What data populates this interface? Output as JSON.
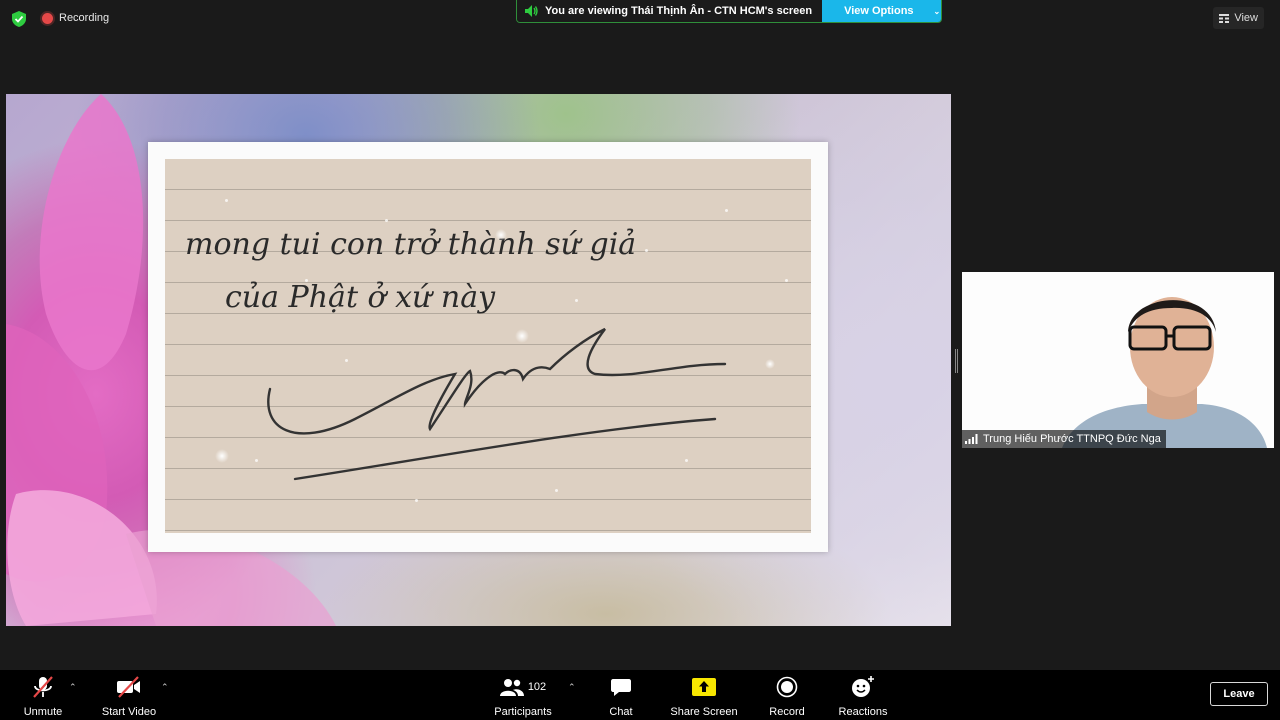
{
  "top_bar": {
    "recording_label": "Recording",
    "viewing_text": "You are viewing Thái Thịnh Ân - CTN HCM's screen",
    "view_options_label": "View Options",
    "view_label": "View"
  },
  "shared_screen": {
    "handwriting_line1": "mong tui con trở thành sứ giả",
    "handwriting_line2": "của Phật ở xứ này"
  },
  "participant_tile": {
    "name": "Trung Hiếu Phước TTNPQ Đức Nga"
  },
  "toolbar": {
    "unmute": "Unmute",
    "start_video": "Start Video",
    "participants": "Participants",
    "participants_count": "102",
    "chat": "Chat",
    "share_screen": "Share Screen",
    "record": "Record",
    "reactions": "Reactions",
    "leave": "Leave"
  },
  "colors": {
    "accent": "#1ab7ea",
    "recording": "#e54848",
    "secure": "#2ecc40",
    "share_screen": "#f7e600"
  },
  "icons": [
    "shield-check-icon",
    "recording-icon",
    "speaker-icon",
    "chevron-down-icon",
    "grid-icon",
    "signal-icon",
    "microphone-muted-icon",
    "video-off-icon",
    "participants-icon",
    "chat-icon",
    "share-screen-icon",
    "record-icon",
    "reactions-icon"
  ]
}
